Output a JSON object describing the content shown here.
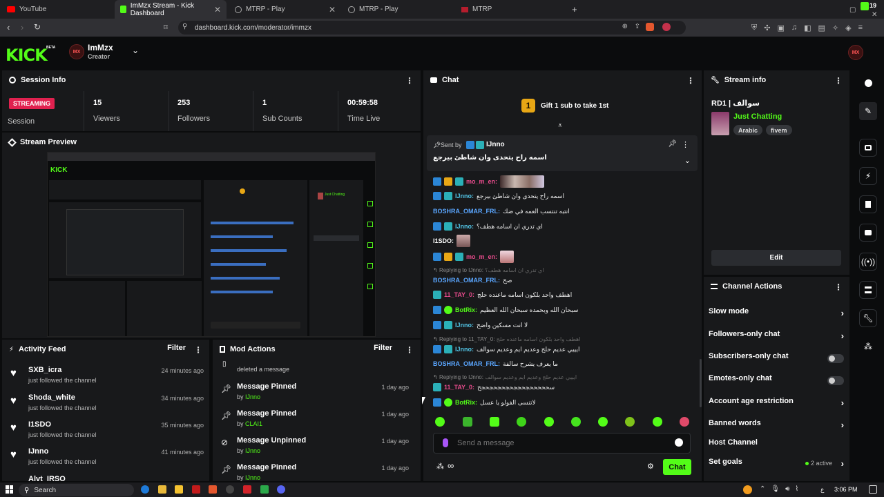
{
  "browser": {
    "tabs": [
      {
        "label": "YouTube"
      },
      {
        "label": "ImMzx Stream - Kick Dashboard"
      },
      {
        "label": "MTRP - Play"
      },
      {
        "label": "MTRP - Play"
      },
      {
        "label": "MTRP"
      }
    ],
    "url": "dashboard.kick.com/moderator/immzx",
    "ext_badge": "19"
  },
  "header": {
    "logo": "KICK",
    "beta": "BETA",
    "channel_name": "ImMzx",
    "role": "Creator",
    "avatar": "MX"
  },
  "session": {
    "title": "Session Info",
    "status": "STREAMING",
    "status_label": "Session",
    "stats": [
      {
        "value": "15",
        "label": "Viewers"
      },
      {
        "value": "253",
        "label": "Followers"
      },
      {
        "value": "1",
        "label": "Sub Counts"
      },
      {
        "value": "00:59:58",
        "label": "Time Live"
      }
    ]
  },
  "preview": {
    "title": "Stream Preview"
  },
  "activity": {
    "title": "Activity Feed",
    "filter": "Filter",
    "items": [
      {
        "name": "SXB_icra",
        "sub": "just followed the channel",
        "time": "24 minutes ago"
      },
      {
        "name": "Shoda_white",
        "sub": "just followed the channel",
        "time": "34 minutes ago"
      },
      {
        "name": "I1SDO",
        "sub": "just followed the channel",
        "time": "35 minutes ago"
      },
      {
        "name": "IJnno",
        "sub": "just followed the channel",
        "time": "41 minutes ago"
      }
    ],
    "partial": "Alvt_IRSO"
  },
  "mod": {
    "title": "Mod Actions",
    "filter": "Filter",
    "top_text": "deleted a message",
    "items": [
      {
        "title": "Message Pinned",
        "by": "by",
        "user": "IJnno",
        "time": "1 day ago"
      },
      {
        "title": "Message Pinned",
        "by": "by",
        "user": "CLAI1",
        "time": "1 day ago"
      },
      {
        "title": "Message Unpinned",
        "by": "by",
        "user": "IJnno",
        "time": "1 day ago"
      },
      {
        "title": "Message Pinned",
        "by": "by",
        "user": "IJnno",
        "time": "1 day ago"
      }
    ]
  },
  "chat": {
    "title": "Chat",
    "gift_num": "1",
    "gift_text": "Gift 1 sub to take 1st",
    "pinned": {
      "sent_by": "Sent by",
      "user": "IJnno",
      "text": "اسمه راح يتحدى وان شاطئ بيرجع"
    },
    "messages": [
      {
        "user": "mo_m_en:",
        "text": "",
        "color": "#e64b8b"
      },
      {
        "user": "IJnno:",
        "text": "اسمه راح يتحدى وان شاطئ بيرجع",
        "color": "#53c6e8"
      },
      {
        "user": "BOSHRA_OMAR_FRL:",
        "text": "انتبه تنتسب العمه في ضك",
        "color": "#5aa6ff"
      },
      {
        "user": "IJnno:",
        "text": "اي تدري ان اسامه هطف؟",
        "color": "#53c6e8"
      },
      {
        "user": "I1SDO:",
        "text": "",
        "color": "#ffffff"
      },
      {
        "user": "mo_m_en:",
        "text": "",
        "color": "#e64b8b"
      },
      {
        "user": "BOSHRA_OMAR_FRL:",
        "text": "صح",
        "color": "#5aa6ff"
      },
      {
        "user": "11_TAY_0:",
        "text": "اهطف واحد بلكون اسامه ماعنده حلج",
        "color": "#e64b8b"
      },
      {
        "user": "BotRix:",
        "text": "سبحان الله وبحمده سبحان الله العظيم",
        "color": "#53fc18"
      },
      {
        "user": "IJnno:",
        "text": "لا انت مسكين واضح",
        "color": "#53c6e8"
      },
      {
        "user": "IJnno:",
        "text": "ايييي عديم حلج وعديم ايم وعديم سوالف",
        "color": "#53c6e8"
      },
      {
        "user": "BOSHRA_OMAR_FRL:",
        "text": "ما يعرف يشرح سالفة",
        "color": "#5aa6ff"
      },
      {
        "user": "11_TAY_0:",
        "text": "سحححححجحججحجحجحجحجح",
        "color": "#e64b8b"
      },
      {
        "user": "BotRix:",
        "text": "لاتنسى الفولو يا عسل",
        "color": "#53fc18"
      }
    ],
    "replies": [
      {
        "text": "Replying to IJnno:",
        "quote": "اي تدري ان اسامه هطف؟"
      },
      {
        "text": "Replying to 11_TAY_0:",
        "quote": "اهطف واحد بلكون اسامه ماعنده حلج"
      },
      {
        "text": "Replying to IJnno:",
        "quote": "ايييي عديم حلج وعديم ايم وعديم سوالف"
      }
    ],
    "input_placeholder": "Send a message",
    "send": "Chat"
  },
  "stream_info": {
    "title": "Stream info",
    "stream_title": "RD1 | سوالف",
    "category": "Just Chatting",
    "tags": [
      "Arabic",
      "fivem"
    ],
    "edit": "Edit"
  },
  "channel_actions": {
    "title": "Channel Actions",
    "items": [
      {
        "label": "Slow mode",
        "control": "chevron"
      },
      {
        "label": "Followers-only chat",
        "control": "chevron"
      },
      {
        "label": "Subscribers-only chat",
        "control": "toggle"
      },
      {
        "label": "Emotes-only chat",
        "control": "toggle"
      },
      {
        "label": "Account age restriction",
        "control": "chevron"
      },
      {
        "label": "Banned words",
        "control": "chevron"
      },
      {
        "label": "Host Channel",
        "control": "none"
      },
      {
        "label": "Set goals",
        "control": "chevron"
      }
    ],
    "goals_active": "2 active"
  },
  "taskbar": {
    "search": "Search",
    "time": "3:06 PM",
    "lang": "ع"
  },
  "colors": {
    "accent": "#53fc18",
    "streaming": "#e0214f",
    "panel": "#18191b",
    "bg": "#0b0c0d"
  }
}
